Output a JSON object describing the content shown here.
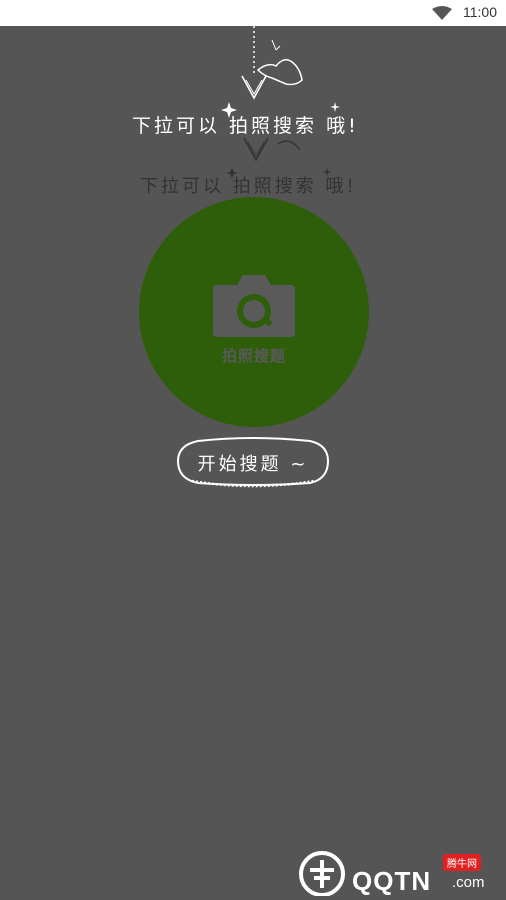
{
  "status_bar": {
    "time": "11:00",
    "wifi_icon": "wifi-icon"
  },
  "hint": {
    "primary_text": "下拉可以 拍照搜索 哦!",
    "secondary_text": "下拉可以 拍照搜索 哦!",
    "icons": [
      "hand-pull-icon",
      "arrow-down-icon",
      "sparkle-icon"
    ]
  },
  "camera_button": {
    "icon": "camera-icon",
    "label": "拍照搜题",
    "color": "#2e5e0a"
  },
  "start_button": {
    "label": "开始搜题 ~"
  },
  "watermark": {
    "brand": "QQTN",
    "suffix": ".com",
    "tag": "腾牛网"
  }
}
